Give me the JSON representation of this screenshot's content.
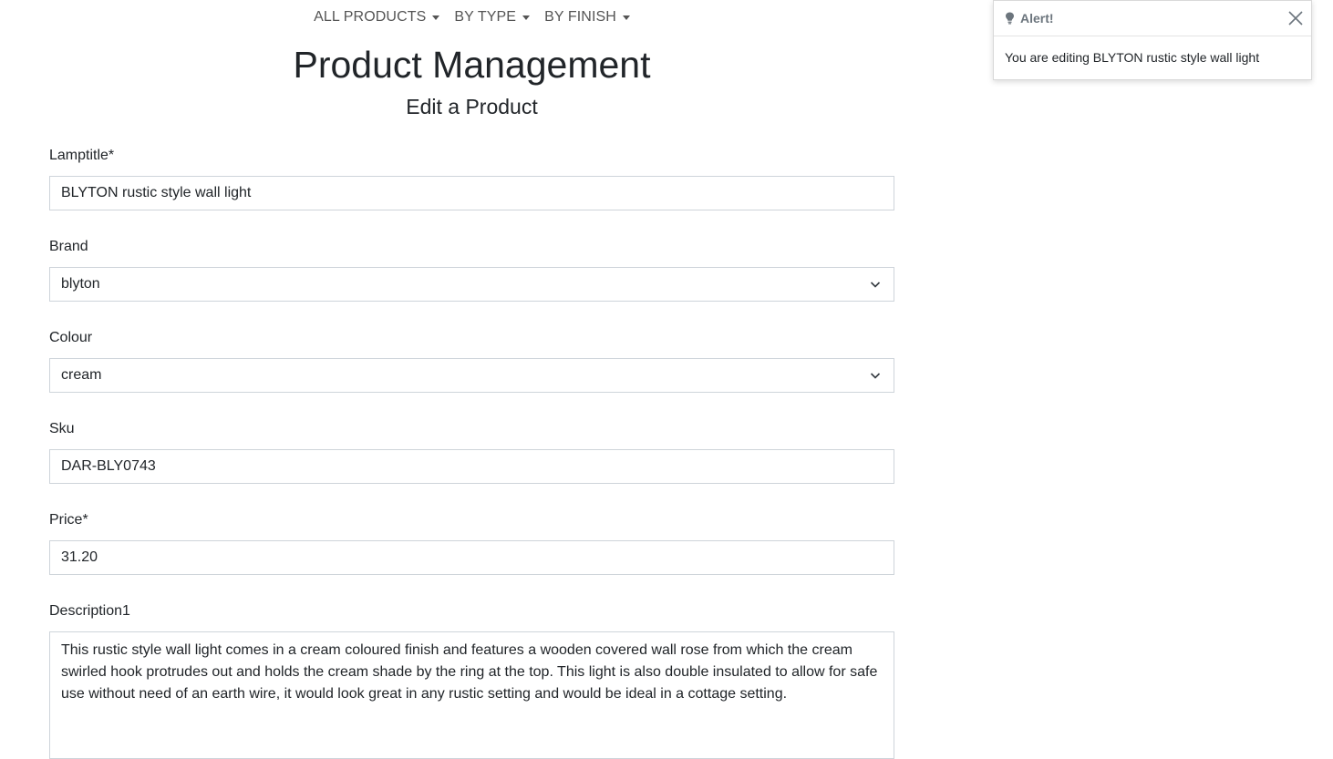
{
  "nav": {
    "items": [
      {
        "label": "ALL PRODUCTS"
      },
      {
        "label": "BY TYPE"
      },
      {
        "label": "BY FINISH"
      }
    ]
  },
  "header": {
    "title": "Product Management",
    "subtitle": "Edit a Product"
  },
  "form": {
    "lamptitle": {
      "label": "Lamptitle*",
      "value": "BLYTON rustic style wall light"
    },
    "brand": {
      "label": "Brand",
      "value": "blyton"
    },
    "colour": {
      "label": "Colour",
      "value": "cream"
    },
    "sku": {
      "label": "Sku",
      "value": "DAR-BLY0743"
    },
    "price": {
      "label": "Price*",
      "value": "31.20"
    },
    "description1": {
      "label": "Description1",
      "value": "This rustic style wall light comes in a cream coloured finish and features a wooden covered wall rose from which the cream swirled hook protrudes out and holds the cream shade by the ring at the top. This light is also double insulated to allow for safe use without need of an earth wire, it would look great in any rustic setting and would be ideal in a cottage setting."
    }
  },
  "toast": {
    "title": "Alert!",
    "message": "You are editing BLYTON rustic style wall light",
    "icon": "lightbulb-icon",
    "close_icon": "close-icon"
  }
}
